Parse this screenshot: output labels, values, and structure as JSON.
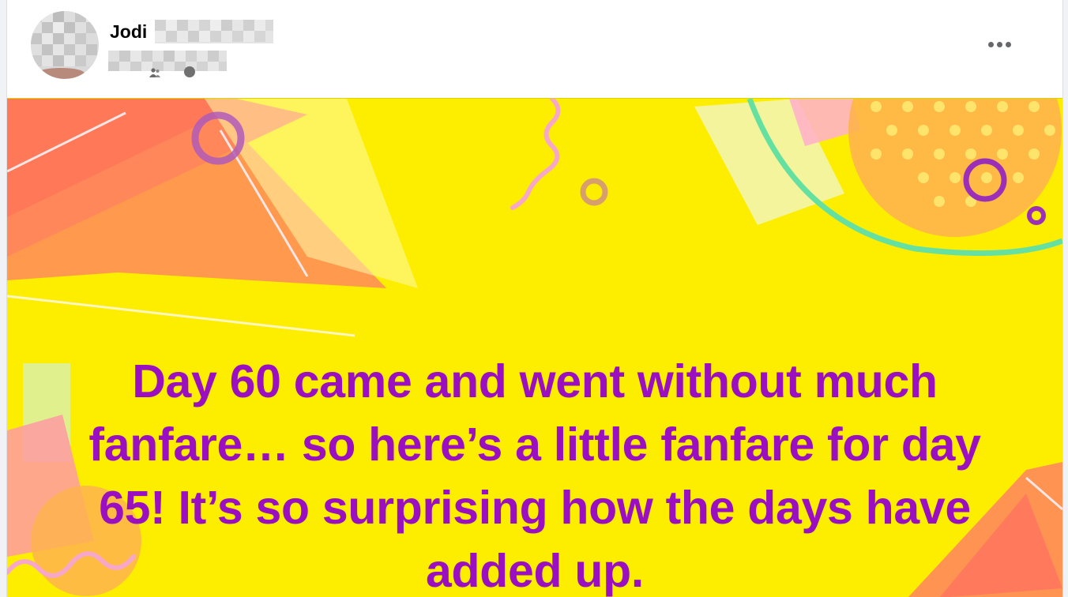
{
  "post": {
    "author_first_name": "Jodi",
    "menu_icon": "ellipsis-horizontal-icon",
    "privacy_icon": "friends-icon",
    "body_text": "Day 60 came and went without much fanfare… so here’s a little fanfare for day 65! It’s so surprising how the days have added up.",
    "background_color": "#fdee00",
    "text_color": "#9a0fbf"
  }
}
